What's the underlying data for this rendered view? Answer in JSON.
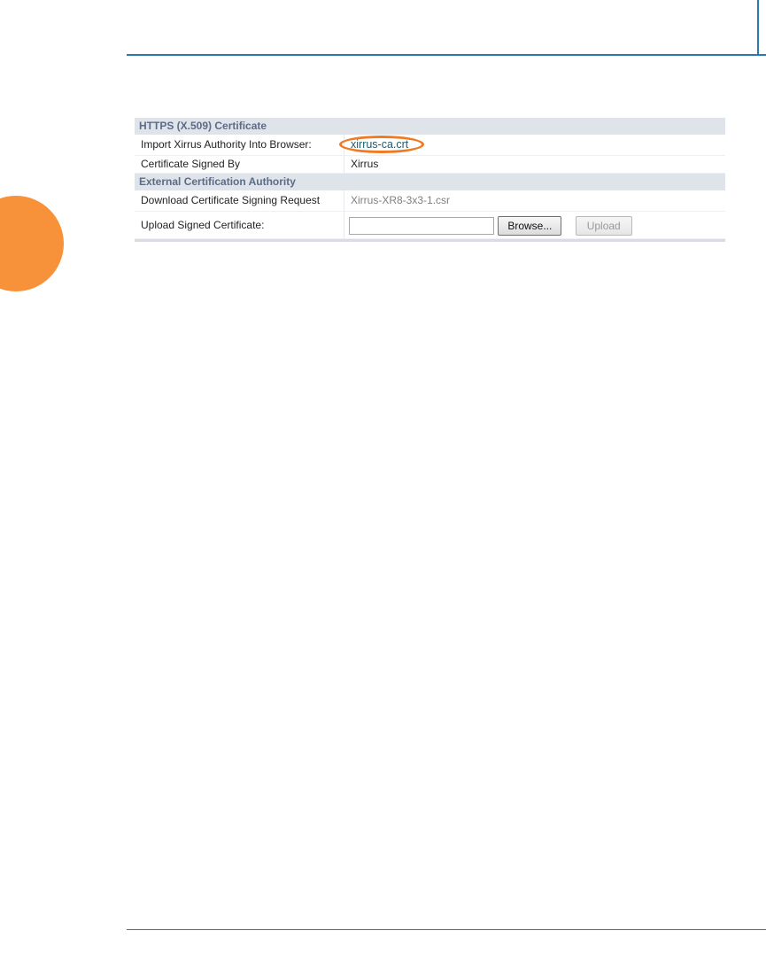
{
  "https_section": {
    "title": "HTTPS (X.509) Certificate",
    "rows": [
      {
        "label": "Import Xirrus Authority Into Browser:",
        "value": "xirrus-ca.crt"
      },
      {
        "label": "Certificate Signed By",
        "value": "Xirrus"
      }
    ]
  },
  "external_section": {
    "title": "External Certification Authority",
    "rows": [
      {
        "label": "Download Certificate Signing Request",
        "value": "Xirrus-XR8-3x3-1.csr"
      },
      {
        "label": "Upload Signed Certificate:"
      }
    ]
  },
  "upload": {
    "file_value": "",
    "browse_label": "Browse...",
    "upload_label": "Upload"
  },
  "colors": {
    "accent_rule": "#2a7ab0",
    "side_tab": "#f7923a",
    "highlight_ring": "#f07a24",
    "section_header_bg": "#dfe3ea",
    "section_header_text": "#5c6c86"
  }
}
